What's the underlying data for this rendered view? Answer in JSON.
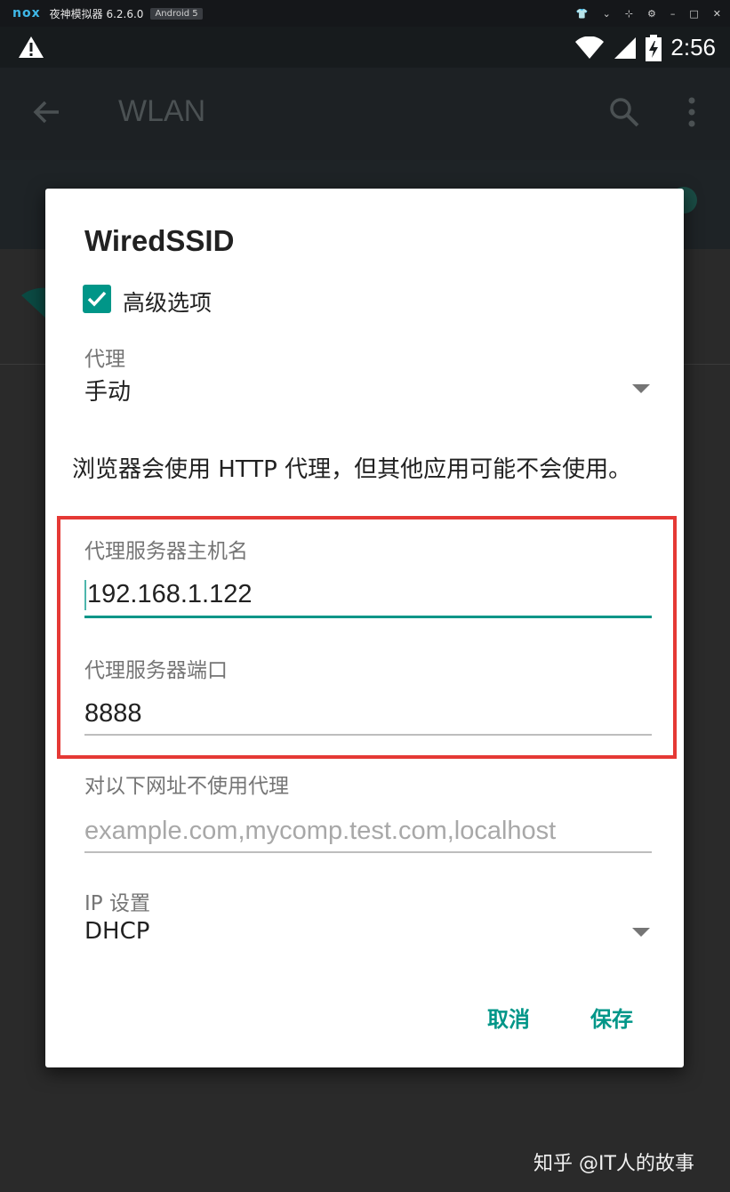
{
  "emulator": {
    "logo": "nox",
    "title": "夜神模拟器 6.2.6.0",
    "badge": "Android 5",
    "controls": [
      "shirt-icon",
      "chevron-down-icon",
      "pin-icon",
      "gear-icon",
      "minimize-icon",
      "maximize-icon",
      "close-icon"
    ],
    "control_glyphs": [
      "👕",
      "⌄",
      "⊹",
      "⚙",
      "–",
      "□",
      "✕"
    ]
  },
  "status_bar": {
    "time": "2:56",
    "icons": [
      "warning-icon",
      "wifi-icon",
      "signal-icon",
      "battery-charging-icon"
    ]
  },
  "app_bar": {
    "title": "WLAN",
    "icons": [
      "back-arrow-icon",
      "search-icon",
      "more-vert-icon"
    ]
  },
  "dialog": {
    "title": "WiredSSID",
    "advanced_options": {
      "label": "高级选项",
      "checked": true
    },
    "proxy": {
      "label": "代理",
      "value": "手动"
    },
    "note": "浏览器会使用 HTTP 代理，但其他应用可能不会使用。",
    "proxy_host": {
      "label": "代理服务器主机名",
      "value": "192.168.1.122"
    },
    "proxy_port": {
      "label": "代理服务器端口",
      "value": "8888"
    },
    "bypass": {
      "label": "对以下网址不使用代理",
      "placeholder": "example.com,mycomp.test.com,localhost"
    },
    "ip_settings": {
      "label": "IP 设置",
      "value": "DHCP"
    },
    "buttons": {
      "cancel": "取消",
      "save": "保存"
    }
  },
  "colors": {
    "accent": "#009688",
    "highlight": "#e53935"
  },
  "watermark": "知乎 @IT人的故事"
}
